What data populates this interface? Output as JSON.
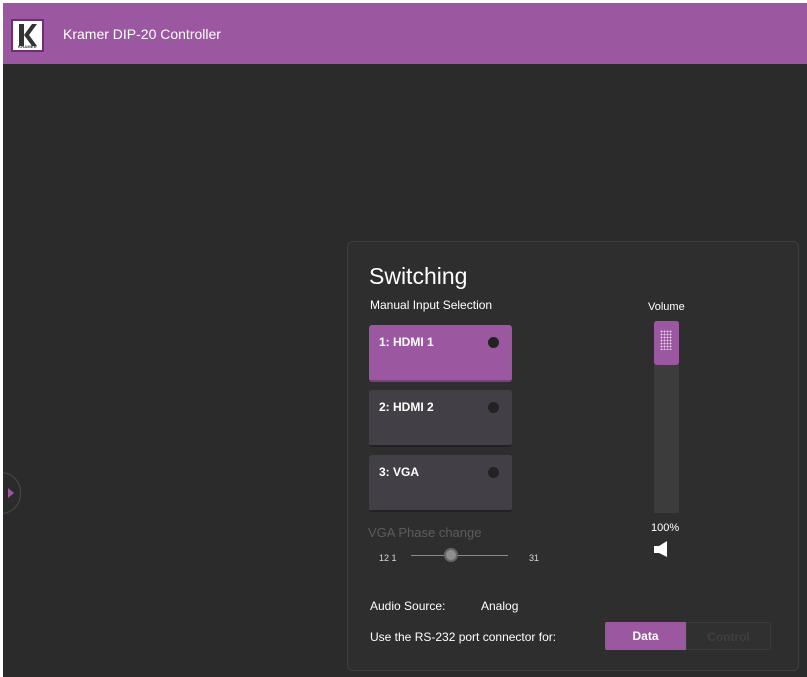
{
  "header": {
    "title": "Kramer DIP-20 Controller",
    "logo_text": "KRAMER",
    "brand_color": "#9b57a0"
  },
  "switching": {
    "title": "Switching",
    "manual_label": "Manual Input Selection",
    "inputs": [
      {
        "label": "1: HDMI 1",
        "active": true
      },
      {
        "label": "2: HDMI 2",
        "active": false
      },
      {
        "label": "3: VGA",
        "active": false
      }
    ],
    "vga_phase": {
      "label": "VGA Phase change",
      "min_label": "12 1",
      "max_label": "31"
    },
    "volume": {
      "label": "Volume",
      "value_text": "100%",
      "level": 1.0,
      "icon": "speaker-icon"
    },
    "audio_source": {
      "label": "Audio Source:",
      "value": "Analog"
    },
    "rs232": {
      "label": "Use the RS-232 port connector for:",
      "options": [
        "Data",
        "Control"
      ],
      "selected": "Data"
    }
  },
  "icons": {
    "side_toggle": "chevron-right-icon"
  }
}
